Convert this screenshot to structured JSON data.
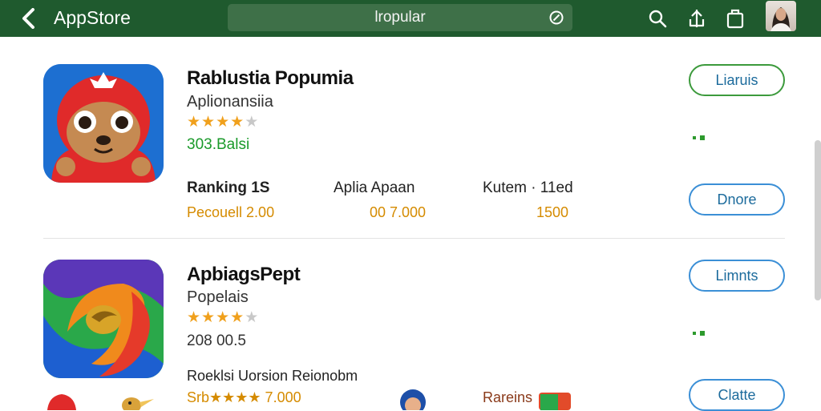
{
  "header": {
    "title": "AppStore",
    "search_value": "lropular"
  },
  "apps": [
    {
      "name": "Rablustia Popumia",
      "subtitle": "Aplionansiia",
      "rating": 4,
      "rating_max": 5,
      "count": "303.Balsi",
      "count_color": "#1a9a2a",
      "stats": [
        {
          "label": "Ranking 1S",
          "value": "Pecouell 2.00"
        },
        {
          "label": "Aplia Apaan",
          "value": "00 7.000"
        },
        {
          "label": "Kutem · 11ed",
          "value": "1500"
        }
      ],
      "buttons": [
        "Liaruis",
        "Dnore"
      ]
    },
    {
      "name": "ApbiagsPept",
      "subtitle": "Popelais",
      "rating": 4,
      "rating_max": 5,
      "count": "208 00.5",
      "count_color": "#333333",
      "stats": [
        {
          "label": "Roeklsi Uorsion Reionobm",
          "value": "Srb★★★★ 7.000"
        },
        {
          "label": "Rareins",
          "value": ""
        }
      ],
      "buttons": [
        "Limnts",
        "Clatte"
      ]
    }
  ],
  "colors": {
    "header_bg": "#1f5a2e",
    "accent_green": "#3c9a3c",
    "accent_blue": "#3b8fd6",
    "star": "#f0a01c"
  }
}
